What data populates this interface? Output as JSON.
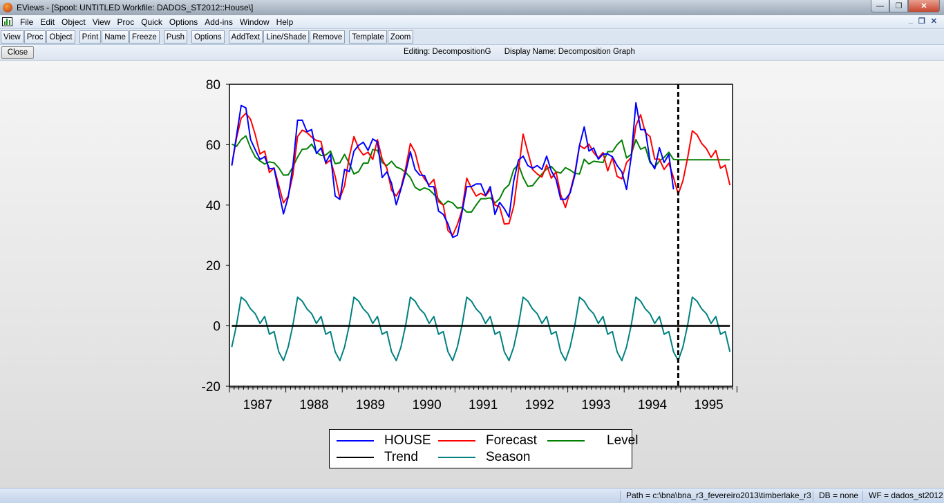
{
  "window": {
    "title": "EViews - [Spool: UNTITLED   Workfile: DADOS_ST2012::House\\]",
    "controls": [
      "minimize",
      "restore",
      "close"
    ]
  },
  "menu": [
    "File",
    "Edit",
    "Object",
    "View",
    "Proc",
    "Quick",
    "Options",
    "Add-ins",
    "Window",
    "Help"
  ],
  "toolbar": [
    "View",
    "Proc",
    "Object",
    "Print",
    "Name",
    "Freeze",
    "Push",
    "Options",
    "AddText",
    "Line/Shade",
    "Remove",
    "Template",
    "Zoom"
  ],
  "closebar": {
    "close_label": "Close",
    "editing": "Editing: DecompositionG",
    "display_name": "Display Name: Decomposition Graph"
  },
  "status": {
    "path": "Path = c:\\bna\\bna_r3_fevereiro2013\\timberlake_r3",
    "db": "DB = none",
    "wf": "WF = dados_st2012"
  },
  "chart_data": {
    "type": "line",
    "frequency": "monthly",
    "sample": [
      "1987M01",
      "1995M11"
    ],
    "forecast_start": "1994M12",
    "ylim": [
      -20,
      80
    ],
    "yticks": [
      "80",
      "60",
      "40",
      "20",
      "0",
      "-20"
    ],
    "xtick_labels": [
      "1987",
      "1988",
      "1989",
      "1990",
      "1991",
      "1992",
      "1993",
      "1994",
      "1995"
    ],
    "grid": false,
    "legend_position": "bottom",
    "series": [
      {
        "name": "HOUSE",
        "color": "#0000ff",
        "values": [
          53.1,
          62.9,
          73.0,
          72.2,
          61.7,
          58.3,
          55.1,
          56.0,
          52.0,
          52.2,
          44.5,
          37.1,
          42.6,
          52.9,
          68.1,
          68.1,
          64.3,
          65.0,
          57.1,
          58.9,
          54.1,
          56.9,
          43.0,
          41.9,
          51.8,
          51.1,
          57.9,
          59.8,
          60.8,
          58.1,
          61.9,
          60.9,
          49.1,
          51.0,
          47.2,
          40.1,
          45.3,
          50.8,
          57.7,
          51.8,
          49.9,
          49.8,
          46.1,
          46.1,
          38.0,
          36.9,
          33.8,
          29.3,
          30.0,
          37.7,
          46.1,
          46.1,
          47.0,
          47.0,
          43.2,
          46.1,
          36.9,
          40.9,
          38.8,
          36.0,
          48.0,
          54.9,
          56.2,
          53.1,
          52.2,
          53.1,
          51.8,
          56.2,
          51.3,
          48.5,
          41.9,
          41.9,
          44.0,
          49.9,
          59.8,
          65.9,
          57.9,
          58.9,
          55.2,
          56.9,
          56.9,
          56.0,
          53.1,
          51.0,
          45.2,
          56.0,
          73.9,
          65.0,
          65.0,
          54.6,
          52.0,
          59.0,
          54.1,
          56.8,
          45.2
        ]
      },
      {
        "name": "Forecast",
        "color": "#ff0000",
        "values": [
          53.1,
          62.1,
          68.8,
          70.4,
          68.4,
          63.3,
          56.9,
          57.9,
          50.8,
          52.3,
          46.5,
          40.7,
          42.9,
          50.0,
          62.7,
          64.8,
          64.0,
          62.5,
          61.4,
          61.0,
          53.7,
          54.9,
          49.5,
          42.2,
          46.4,
          56.0,
          62.7,
          58.7,
          56.6,
          57.5,
          55.1,
          61.7,
          55.2,
          52.2,
          44.9,
          43.0,
          45.7,
          52.2,
          60.4,
          57.5,
          51.4,
          48.7,
          46.7,
          48.5,
          41.1,
          40.0,
          31.6,
          30.0,
          33.5,
          38.4,
          48.9,
          45.7,
          43.0,
          43.9,
          43.0,
          45.1,
          40.0,
          39.4,
          33.7,
          33.9,
          39.6,
          51.4,
          63.5,
          57.5,
          51.8,
          50.3,
          49.3,
          53.3,
          48.9,
          51.0,
          43.4,
          39.2,
          44.5,
          50.6,
          59.8,
          58.7,
          60.2,
          57.4,
          55.6,
          57.4,
          51.3,
          55.8,
          49.5,
          48.7,
          54.1,
          55.8,
          66.3,
          69.9,
          64.0,
          62.7,
          55.2,
          55.2,
          51.8,
          53.9,
          49.1,
          43.6,
          48.0,
          55.6,
          64.6,
          63.3,
          60.4,
          58.7,
          55.8,
          58.1,
          52.2,
          53.2,
          46.6
        ]
      },
      {
        "name": "Level",
        "color": "#008000",
        "values": [
          60.2,
          59.4,
          61.7,
          62.9,
          58.9,
          55.9,
          54.6,
          53.6,
          54.3,
          54.0,
          52.3,
          49.9,
          50.0,
          52.6,
          55.9,
          58.5,
          58.6,
          60.2,
          57.5,
          56.4,
          56.6,
          57.9,
          53.7,
          54.0,
          56.8,
          53.7,
          50.3,
          51.1,
          53.9,
          53.9,
          58.4,
          58.1,
          54.1,
          53.1,
          54.5,
          52.6,
          52.0,
          50.8,
          49.1,
          45.9,
          44.9,
          45.7,
          45.1,
          43.6,
          41.9,
          40.0,
          41.3,
          40.7,
          39.0,
          39.2,
          37.7,
          37.7,
          40.0,
          42.1,
          42.1,
          42.4,
          40.7,
          42.1,
          45.3,
          46.7,
          51.8,
          53.5,
          49.1,
          46.2,
          46.4,
          48.4,
          50.3,
          52.0,
          52.8,
          51.0,
          50.6,
          52.4,
          51.6,
          50.5,
          50.3,
          55.2,
          53.6,
          54.5,
          54.3,
          54.1,
          57.7,
          57.7,
          60.0,
          61.5,
          55.6,
          56.8,
          61.7,
          58.5,
          59.2,
          54.1,
          52.6,
          54.6,
          55.8,
          57.5,
          55.1,
          55.0,
          55.0,
          55.0,
          55.0,
          55.0,
          55.0,
          55.0,
          55.0,
          55.0,
          55.0,
          55.0,
          55.0
        ]
      },
      {
        "name": "Trend",
        "color": "#000000",
        "values": [
          0,
          0,
          0,
          0,
          0,
          0,
          0,
          0,
          0,
          0,
          0,
          0,
          0,
          0,
          0,
          0,
          0,
          0,
          0,
          0,
          0,
          0,
          0,
          0,
          0,
          0,
          0,
          0,
          0,
          0,
          0,
          0,
          0,
          0,
          0,
          0,
          0,
          0,
          0,
          0,
          0,
          0,
          0,
          0,
          0,
          0,
          0,
          0,
          0,
          0,
          0,
          0,
          0,
          0,
          0,
          0,
          0,
          0,
          0,
          0,
          0,
          0,
          0,
          0,
          0,
          0,
          0,
          0,
          0,
          0,
          0,
          0,
          0,
          0,
          0,
          0,
          0,
          0,
          0,
          0,
          0,
          0,
          0,
          0,
          0,
          0,
          0,
          0,
          0,
          0,
          0,
          0,
          0,
          0,
          0,
          0,
          0,
          0,
          0,
          0,
          0,
          0,
          0,
          0,
          0,
          0,
          0
        ]
      },
      {
        "name": "Season",
        "color": "#008080",
        "values": [
          -7.0,
          0.2,
          9.5,
          8.2,
          5.6,
          4.0,
          0.8,
          3.1,
          -2.8,
          -1.9,
          -8.6,
          -11.5,
          -7.0,
          0.2,
          9.5,
          8.2,
          5.6,
          4.0,
          0.8,
          3.1,
          -2.8,
          -1.9,
          -8.6,
          -11.5,
          -7.0,
          0.2,
          9.5,
          8.2,
          5.6,
          4.0,
          0.8,
          3.1,
          -2.8,
          -1.9,
          -8.6,
          -11.5,
          -7.0,
          0.2,
          9.5,
          8.2,
          5.6,
          4.0,
          0.8,
          3.1,
          -2.8,
          -1.9,
          -8.6,
          -11.5,
          -7.0,
          0.2,
          9.5,
          8.2,
          5.6,
          4.0,
          0.8,
          3.1,
          -2.8,
          -1.9,
          -8.6,
          -11.5,
          -7.0,
          0.2,
          9.5,
          8.2,
          5.6,
          4.0,
          0.8,
          3.1,
          -2.8,
          -1.9,
          -8.6,
          -11.5,
          -7.0,
          0.2,
          9.5,
          8.2,
          5.6,
          4.0,
          0.8,
          3.1,
          -2.8,
          -1.9,
          -8.6,
          -11.5,
          -7.0,
          0.2,
          9.5,
          8.2,
          5.6,
          4.0,
          0.8,
          3.1,
          -2.8,
          -1.9,
          -8.6,
          -11.5,
          -7.0,
          0.2,
          9.5,
          8.2,
          5.6,
          4.0,
          0.8,
          3.1,
          -2.8,
          -1.9,
          -8.6
        ]
      }
    ]
  }
}
